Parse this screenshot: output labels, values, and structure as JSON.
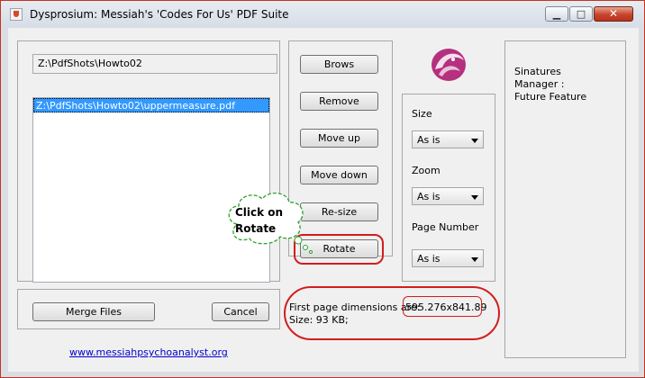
{
  "window": {
    "title": "Dysprosium: Messiah's 'Codes For Us' PDF Suite",
    "controls": {
      "minimize": "▁",
      "maximize": "□",
      "close": "✕"
    },
    "accent_color": "#c7452c"
  },
  "path_field": {
    "value": "Z:\\PdfShots\\Howto02"
  },
  "file_list": {
    "items": [
      "Z:\\PdfShots\\Howto02\\uppermeasure.pdf"
    ],
    "selected_index": 0
  },
  "buttons": {
    "browse": "Brows",
    "remove": "Remove",
    "move_up": "Move up",
    "move_down": "Move down",
    "resize": "Re-size",
    "rotate": "Rotate",
    "merge": "Merge Files",
    "cancel": "Cancel"
  },
  "options": {
    "size_label": "Size",
    "size_value": "As is",
    "zoom_label": "Zoom",
    "zoom_value": "As is",
    "page_number_label": "Page Number",
    "page_number_value": "As is"
  },
  "signatures": {
    "line1": "Sinatures",
    "line2": "Manager :",
    "line3": "Future Feature"
  },
  "info": {
    "dimensions_label": "First page dimensions are:",
    "dimensions_value": "595.276x841.89",
    "size_text": "Size: 93 KB;"
  },
  "footer": {
    "link": "www.messiahpsychoanalyst.org"
  },
  "annotation": {
    "line1": "Click on",
    "line2": "Rotate",
    "color": "#d21e1e"
  },
  "logo": {
    "name": "phoenix-logo",
    "color": "#b5307f"
  }
}
